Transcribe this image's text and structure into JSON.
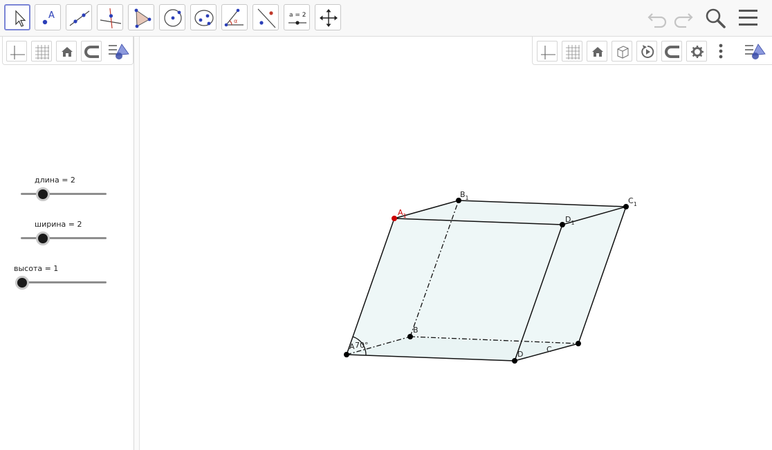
{
  "toolbar": {
    "tools": [
      {
        "name": "move-tool",
        "selected": true
      },
      {
        "name": "point-tool",
        "label": "A"
      },
      {
        "name": "line-tool"
      },
      {
        "name": "perpendicular-line-tool"
      },
      {
        "name": "polygon-tool"
      },
      {
        "name": "circle-tool"
      },
      {
        "name": "ellipse-tool"
      },
      {
        "name": "angle-tool",
        "label": "α"
      },
      {
        "name": "reflect-tool"
      },
      {
        "name": "slider-tool",
        "label": "a = 2"
      },
      {
        "name": "move-graphics-view-tool"
      }
    ],
    "right_icons": [
      "undo-icon",
      "redo-icon",
      "search-icon",
      "menu-icon"
    ]
  },
  "sliders": [
    {
      "label": "длина = 2",
      "value": 2
    },
    {
      "label": "ширина = 2",
      "value": 2
    },
    {
      "label": "высота = 1",
      "value": 1
    }
  ],
  "points": {
    "A1": {
      "main": "A",
      "sub": "1"
    },
    "B1": {
      "main": "B",
      "sub": "1"
    },
    "C1": {
      "main": "C",
      "sub": "1"
    },
    "D1": {
      "main": "D",
      "sub": "1"
    },
    "A": "A",
    "B": "B",
    "C": "C",
    "D": "D"
  },
  "angle_label": "70°",
  "colors": {
    "accent": "#7b85d6",
    "face_fill": "#e3f1f1",
    "point_red": "#cc0000",
    "point_black": "#000000"
  }
}
